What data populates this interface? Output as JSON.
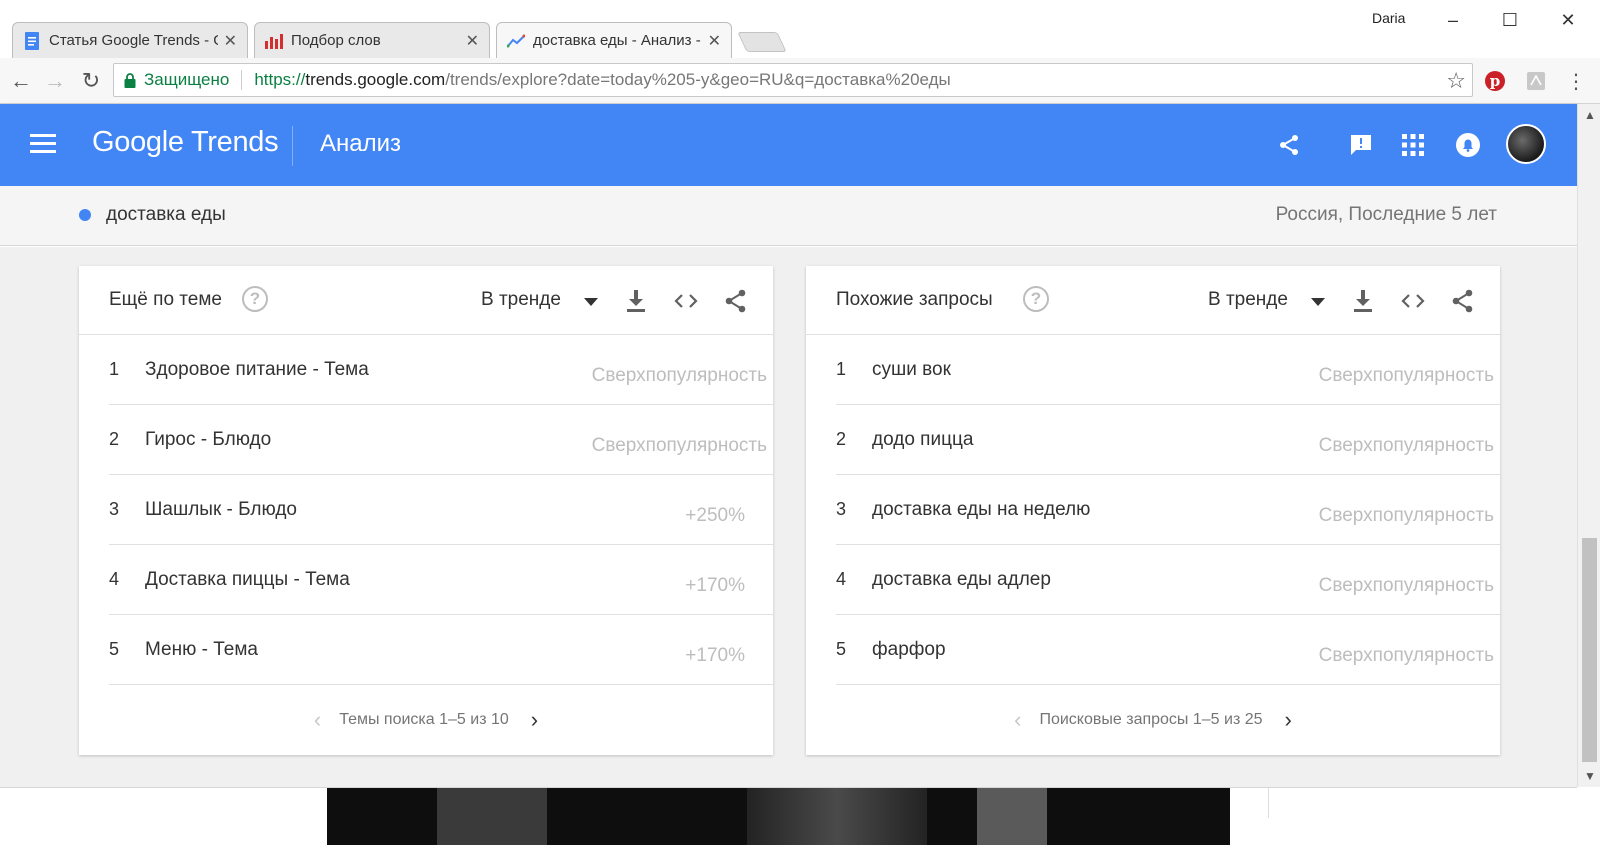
{
  "browser": {
    "tabs": [
      {
        "label": "Статья Google Trends - G",
        "icon": "docs-icon"
      },
      {
        "label": "Подбор слов",
        "icon": "bar-chart-icon"
      },
      {
        "label": "доставка еды - Анализ -",
        "icon": "trends-icon"
      }
    ],
    "user": "Daria",
    "secure_label": "Защищено",
    "url": {
      "scheme": "https://",
      "host": "trends.google.com",
      "path": "/trends/explore?date=today%205-y&geo=RU&q=доставка%20еды"
    }
  },
  "header": {
    "logo": "Google Trends",
    "title": "Анализ"
  },
  "term": {
    "name": "доставка еды",
    "scope": "Россия, Последние 5 лет",
    "color": "#4285f4"
  },
  "topics": {
    "title": "Ещё по теме",
    "filter": "В тренде",
    "rows": [
      {
        "rank": "1",
        "text": "Здоровое питание - Тема",
        "value": "Сверхпопулярность"
      },
      {
        "rank": "2",
        "text": "Гирос - Блюдо",
        "value": "Сверхпопулярность"
      },
      {
        "rank": "3",
        "text": "Шашлык - Блюдо",
        "value": "+250%"
      },
      {
        "rank": "4",
        "text": "Доставка пиццы - Тема",
        "value": "+170%"
      },
      {
        "rank": "5",
        "text": "Меню - Тема",
        "value": "+170%"
      }
    ],
    "pager": "Темы поиска 1–5 из 10"
  },
  "queries": {
    "title": "Похожие запросы",
    "filter": "В тренде",
    "rows": [
      {
        "rank": "1",
        "text": "суши вок",
        "value": "Сверхпопулярность"
      },
      {
        "rank": "2",
        "text": "додо пицца",
        "value": "Сверхпопулярность"
      },
      {
        "rank": "3",
        "text": "доставка еды на неделю",
        "value": "Сверхпопулярность"
      },
      {
        "rank": "4",
        "text": "доставка еды адлер",
        "value": "Сверхпопулярность"
      },
      {
        "rank": "5",
        "text": "фарфор",
        "value": "Сверхпопулярность"
      }
    ],
    "pager": "Поисковые запросы 1–5 из 25"
  },
  "colors": {
    "brand": "#4285f4",
    "secure": "#0b8043",
    "muted": "#bdbdbd"
  }
}
